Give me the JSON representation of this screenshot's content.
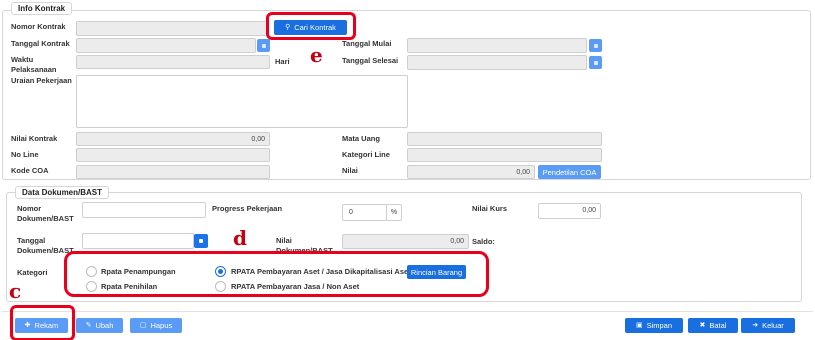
{
  "info": {
    "legend": "Info Kontrak",
    "nomor_kontrak_label": "Nomor Kontrak",
    "cari_kontrak_label": "Cari Kontrak",
    "tanggal_kontrak_label": "Tanggal Kontrak",
    "tanggal_mulai_label": "Tanggal Mulai",
    "waktu_pelaksanaan_label": "Waktu Pelaksanaan",
    "hari_label": "Hari",
    "tanggal_selesai_label": "Tanggal Selesai",
    "uraian_pekerjaan_label": "Uraian Pekerjaan",
    "nilai_kontrak_label": "Nilai Kontrak",
    "nilai_kontrak_value": "0,00",
    "mata_uang_label": "Mata Uang",
    "no_line_label": "No Line",
    "kategori_line_label": "Kategori Line",
    "kode_coa_label": "Kode COA",
    "nilai_label": "Nilai",
    "nilai_value": "0,00",
    "pendetilan_coa_label": "Pendetilan COA"
  },
  "dok": {
    "legend": "Data Dokumen/BAST",
    "nomor_dokumen_label": "Nomor Dokumen/BAST",
    "progress_label": "Progress Pekerjaan",
    "progress_value": "0",
    "progress_unit": "%",
    "nilai_kurs_label": "Nilai Kurs",
    "nilai_kurs_value": "0,00",
    "tanggal_dokumen_label": "Tanggal Dokumen/BAST",
    "nilai_dokumen_label": "Nilai Dokumen/BAST",
    "nilai_dokumen_value": "0,00",
    "saldo_label": "Saldo:",
    "kategori_label": "Kategori",
    "opt_penampungan": "Rpata Penampungan",
    "opt_penihilan": "Rpata Penihilan",
    "opt_pembayaran_aset": "RPATA Pembayaran Aset / Jasa Dikapitalisasi Aset",
    "opt_pembayaran_jasa": "RPATA Pembayaran Jasa / Non Aset",
    "selected_option": "RPATA Pembayaran Aset / Jasa Dikapitalisasi Aset",
    "rincian_barang_label": "Rincian Barang"
  },
  "footer": {
    "rekam": "Rekam",
    "ubah": "Ubah",
    "hapus": "Hapus",
    "simpan": "Simpan",
    "batal": "Batal",
    "keluar": "Keluar"
  },
  "annotations": {
    "e": "e",
    "d": "d",
    "c": "c"
  },
  "colors": {
    "primary": "#1a6fe0",
    "light_primary": "#5a9bf5",
    "highlight": "#e8001c",
    "annotation": "#c40010"
  }
}
